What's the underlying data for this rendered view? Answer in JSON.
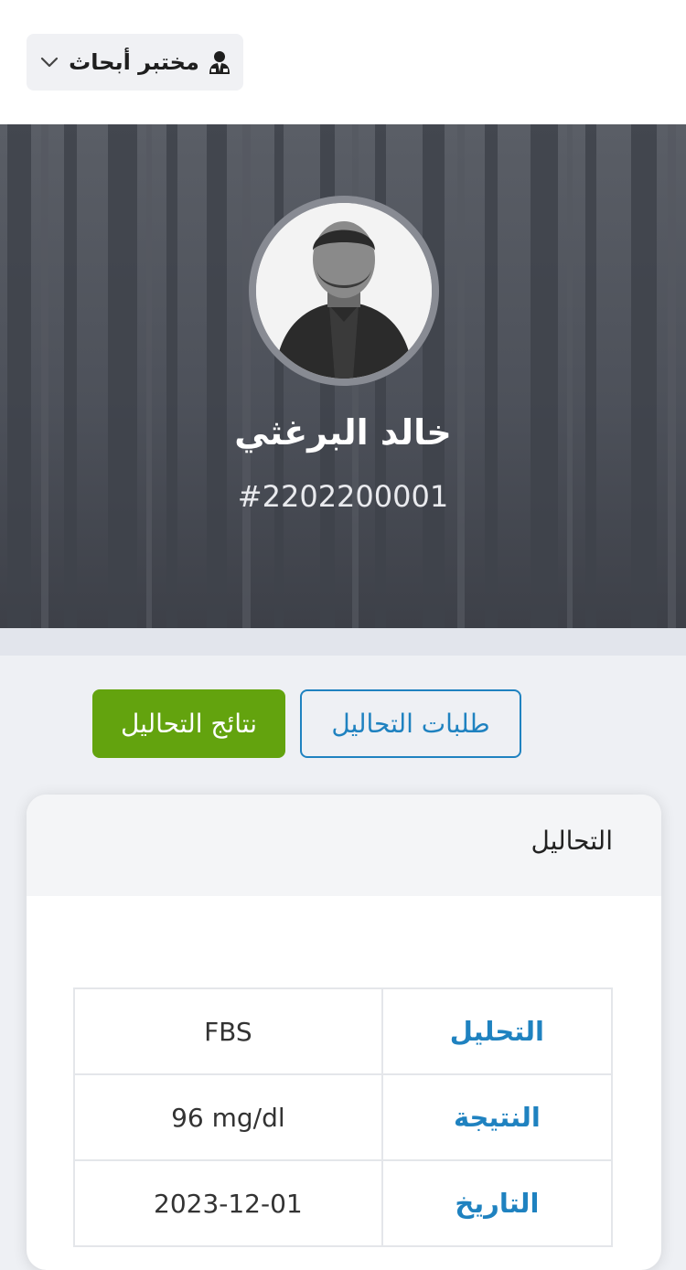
{
  "header": {
    "lab_dropdown_label": "مختبر أبحاث",
    "icons": [
      "user-tie-icon",
      "chevron-down-icon"
    ]
  },
  "profile": {
    "name": "خالد البرغثي",
    "patient_id": "#2202200001",
    "avatar": "profile-photo"
  },
  "tabs": {
    "requests_label": "طلبات التحاليل",
    "results_label": "نتائج التحاليل",
    "active": "results"
  },
  "card": {
    "title": "التحاليل",
    "rows": [
      {
        "label": "التحليل",
        "value": "FBS"
      },
      {
        "label": "النتيجة",
        "value": "96 mg/dl"
      },
      {
        "label": "التاريخ",
        "value": "2023-12-01"
      }
    ]
  },
  "colors": {
    "accent_blue": "#1f82c0",
    "accent_green": "#63a30e",
    "hero_overlay": "#4a4f5a"
  }
}
